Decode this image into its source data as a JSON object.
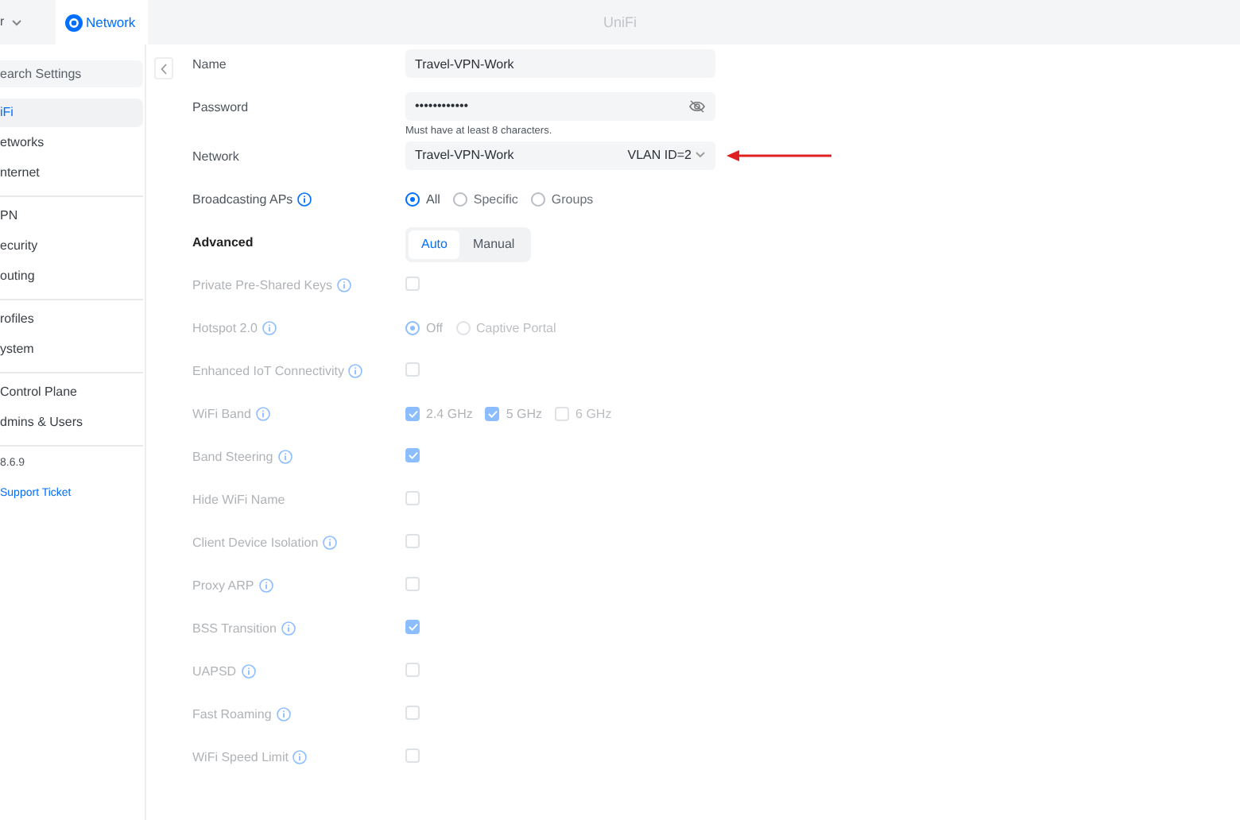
{
  "topbar": {
    "left_text": "r",
    "tab": {
      "label": "Network",
      "selected": true
    },
    "title": "UniFi"
  },
  "sidebar": {
    "search": {
      "placeholder": "earch Settings"
    },
    "groups": [
      [
        {
          "label": "iFi",
          "selected": true
        },
        {
          "label": "etworks",
          "selected": false
        },
        {
          "label": "nternet",
          "selected": false
        }
      ],
      [
        {
          "label": "PN",
          "selected": false
        },
        {
          "label": "ecurity",
          "selected": false
        },
        {
          "label": "outing",
          "selected": false
        }
      ],
      [
        {
          "label": "rofiles",
          "selected": false
        },
        {
          "label": "ystem",
          "selected": false
        }
      ],
      [
        {
          "label": "Control Plane",
          "selected": false
        },
        {
          "label": "dmins & Users",
          "selected": false
        }
      ]
    ],
    "version": "8.6.9",
    "link": "Support Ticket"
  },
  "form": [
    {
      "kind": "text",
      "label": "Name",
      "value": "Travel-VPN-Work",
      "disabled": false,
      "info": false
    },
    {
      "kind": "password",
      "label": "Password",
      "value": "••••••••••••",
      "hint": "Must have at least 8 characters.",
      "disabled": false,
      "info": false
    },
    {
      "kind": "select",
      "label": "Network",
      "value": "Travel-VPN-Work",
      "suffix": "VLAN ID=2",
      "disabled": false,
      "info": false,
      "highlighted": true
    },
    {
      "kind": "radio",
      "label": "Broadcasting APs",
      "disabled": false,
      "info": true,
      "options": [
        {
          "label": "All",
          "selected": true
        },
        {
          "label": "Specific",
          "selected": false
        },
        {
          "label": "Groups",
          "selected": false
        }
      ]
    },
    {
      "kind": "segmented",
      "label": "Advanced",
      "disabled": false,
      "info": false,
      "options": [
        {
          "label": "Auto",
          "selected": true
        },
        {
          "label": "Manual",
          "selected": false
        }
      ]
    },
    {
      "kind": "checkbox",
      "label": "Private Pre-Shared Keys",
      "disabled": true,
      "info": true,
      "checked": false
    },
    {
      "kind": "radio",
      "label": "Hotspot 2.0",
      "disabled": true,
      "info": true,
      "options": [
        {
          "label": "Off",
          "selected": true
        },
        {
          "label": "Captive Portal",
          "selected": false
        }
      ]
    },
    {
      "kind": "checkbox",
      "label": "Enhanced IoT Connectivity",
      "disabled": true,
      "info": true,
      "checked": false
    },
    {
      "kind": "checkboxes",
      "label": "WiFi Band",
      "disabled": true,
      "info": true,
      "options": [
        {
          "label": "2.4 GHz",
          "checked": true
        },
        {
          "label": "5 GHz",
          "checked": true
        },
        {
          "label": "6 GHz",
          "checked": false
        }
      ]
    },
    {
      "kind": "checkbox",
      "label": "Band Steering",
      "disabled": true,
      "info": true,
      "checked": true
    },
    {
      "kind": "checkbox",
      "label": "Hide WiFi Name",
      "disabled": true,
      "info": false,
      "checked": false
    },
    {
      "kind": "checkbox",
      "label": "Client Device Isolation",
      "disabled": true,
      "info": true,
      "checked": false
    },
    {
      "kind": "checkbox",
      "label": "Proxy ARP",
      "disabled": true,
      "info": true,
      "checked": false
    },
    {
      "kind": "checkbox",
      "label": "BSS Transition",
      "disabled": true,
      "info": true,
      "checked": true
    },
    {
      "kind": "checkbox",
      "label": "UAPSD",
      "disabled": true,
      "info": true,
      "checked": false
    },
    {
      "kind": "checkbox",
      "label": "Fast Roaming",
      "disabled": true,
      "info": true,
      "checked": false
    },
    {
      "kind": "checkbox",
      "label": "WiFi Speed Limit",
      "disabled": true,
      "info": true,
      "checked": false
    }
  ]
}
